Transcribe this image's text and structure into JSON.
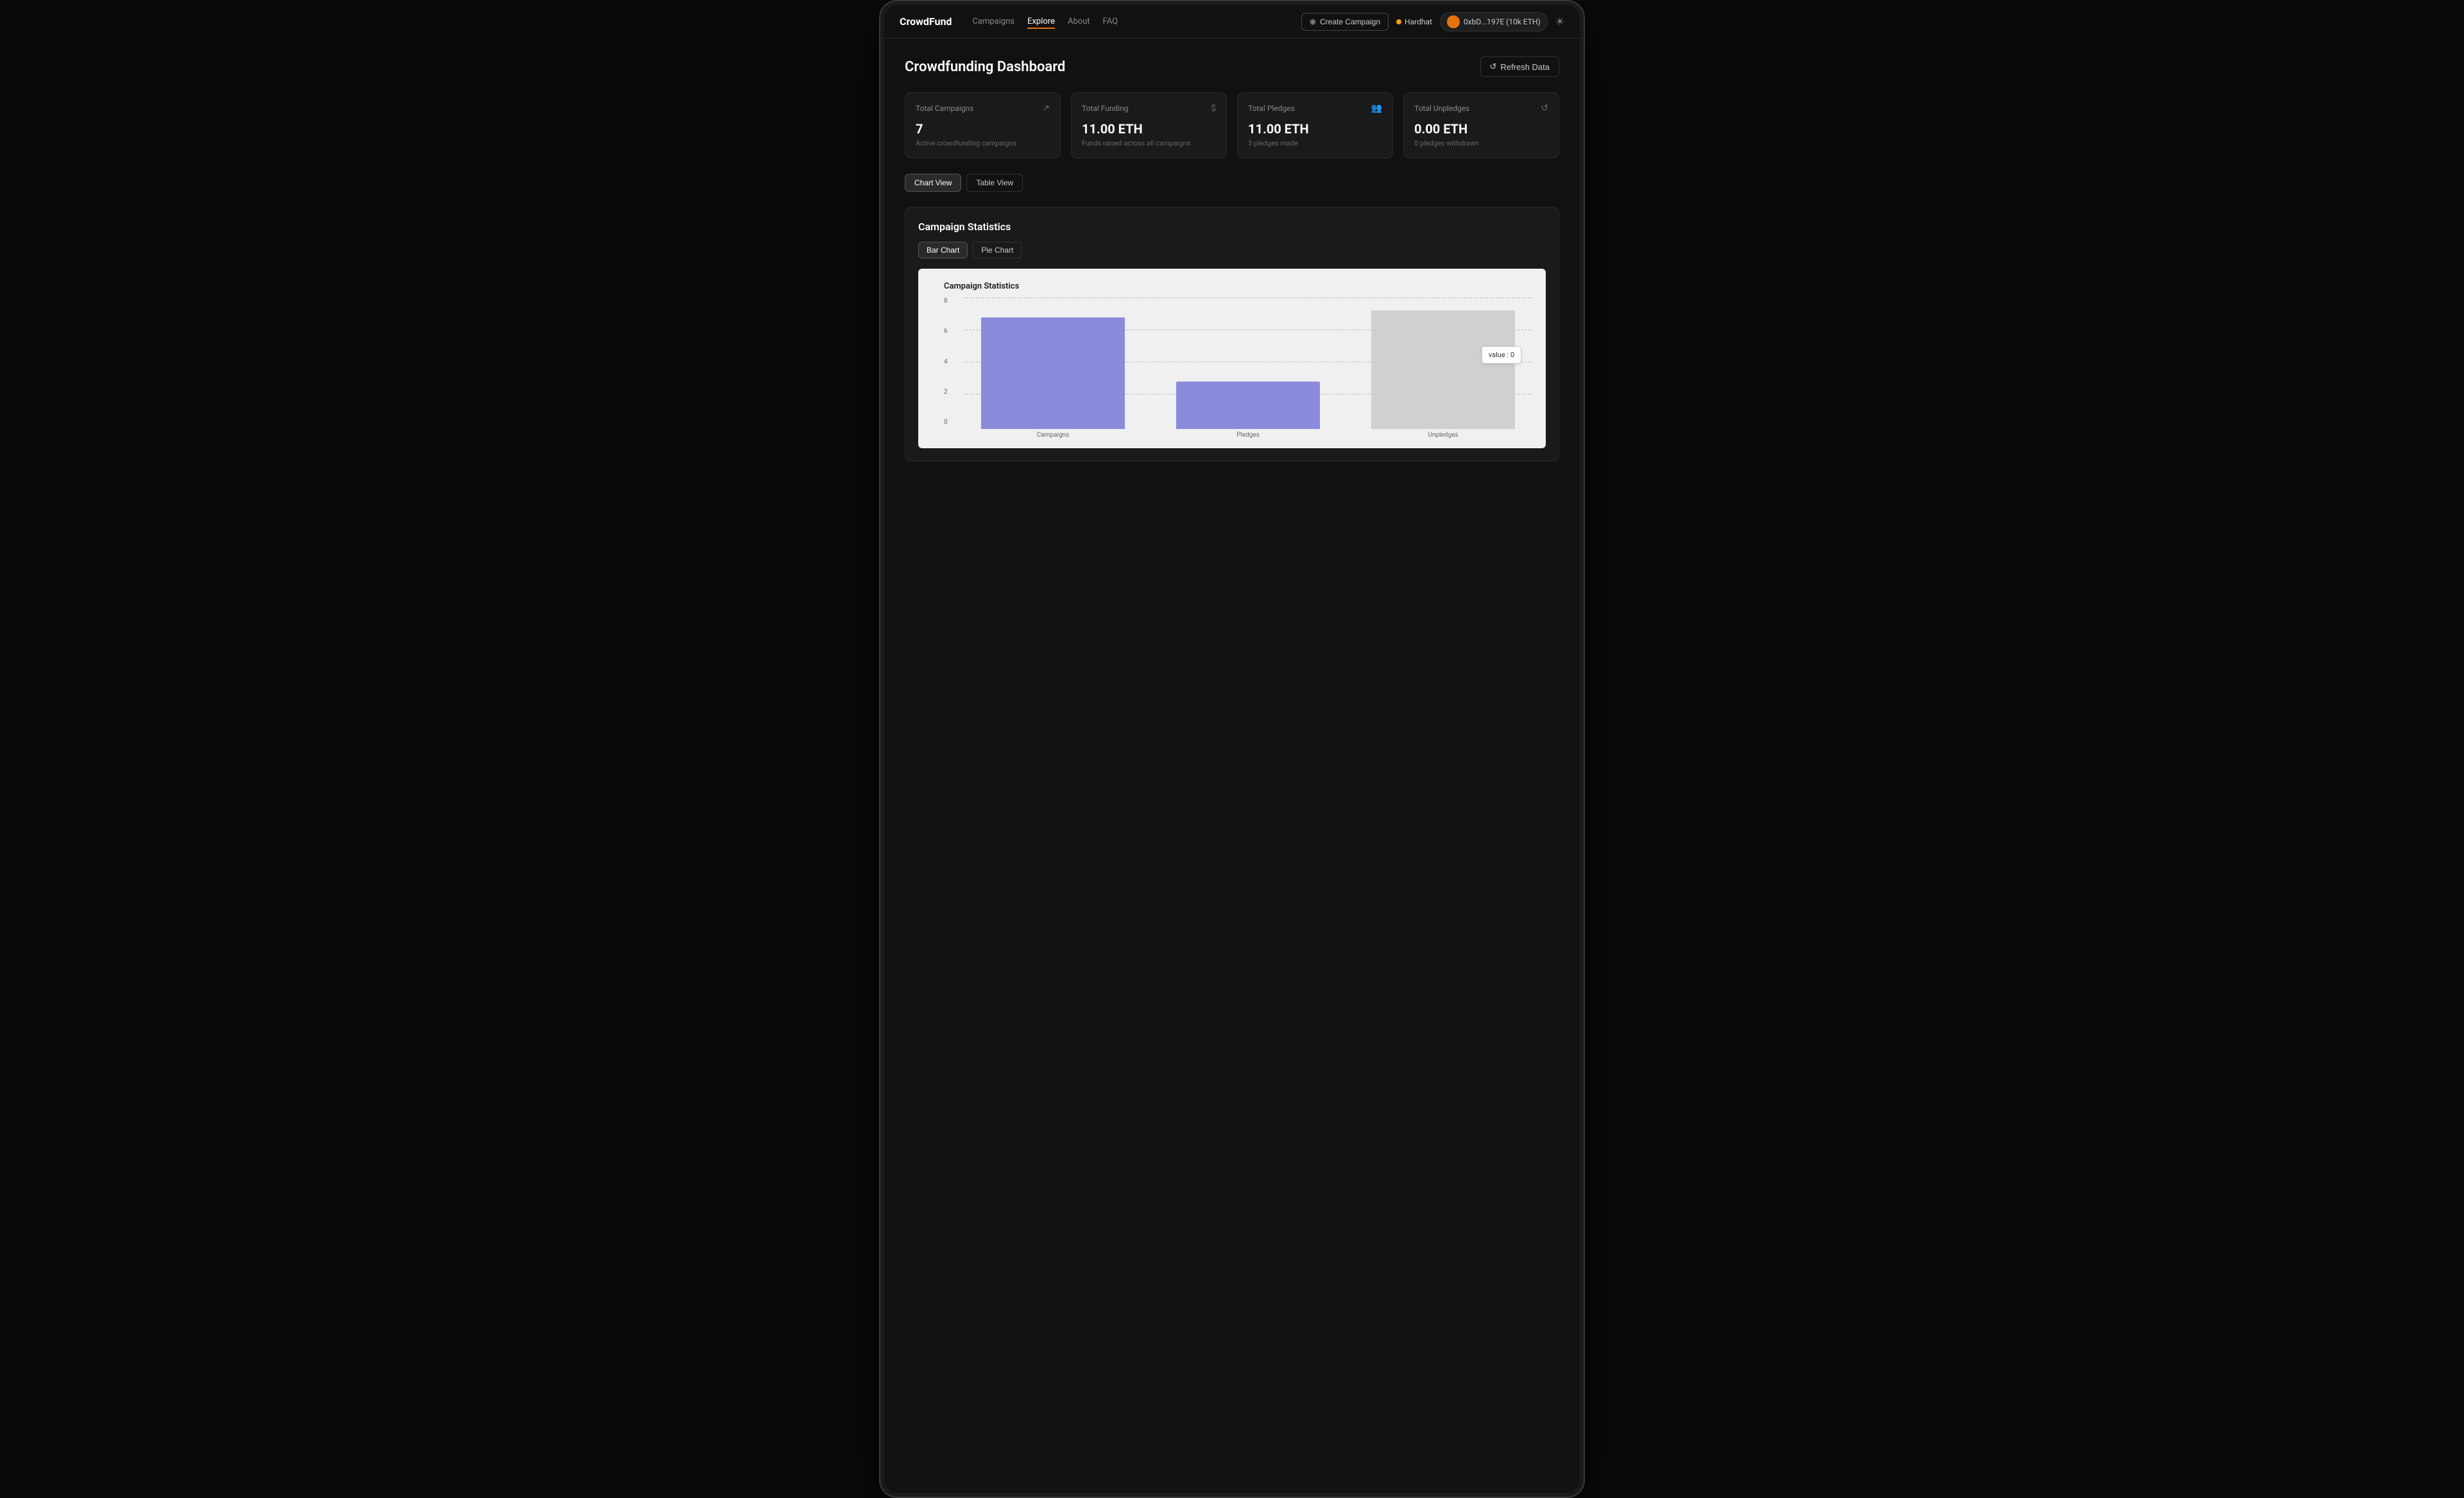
{
  "app": {
    "logo": "CrowdFund",
    "nav_links": [
      {
        "label": "Campaigns",
        "active": false
      },
      {
        "label": "Explore",
        "active": true
      },
      {
        "label": "About",
        "active": false
      },
      {
        "label": "FAQ",
        "active": false
      }
    ],
    "create_campaign_label": "Create Campaign",
    "network_label": "Hardhat",
    "wallet_address": "0xbD...197E (10k ETH)",
    "theme_icon": "☀"
  },
  "dashboard": {
    "title": "Crowdfunding Dashboard",
    "refresh_label": "Refresh Data",
    "stats": [
      {
        "label": "Total Campaigns",
        "icon": "↗",
        "value": "7",
        "sub": "Active crowdfunding campaigns"
      },
      {
        "label": "Total Funding",
        "icon": "$",
        "value": "11.00 ETH",
        "sub": "Funds raised across all campaigns"
      },
      {
        "label": "Total Pledges",
        "icon": "👥",
        "value": "11.00 ETH",
        "sub": "3 pledges made"
      },
      {
        "label": "Total Unpledges",
        "icon": "↺",
        "value": "0.00 ETH",
        "sub": "0 pledges withdrawn"
      }
    ],
    "view_buttons": [
      {
        "label": "Chart View",
        "active": true
      },
      {
        "label": "Table View",
        "active": false
      }
    ],
    "chart_section": {
      "title": "Campaign Statistics",
      "chart_types": [
        {
          "label": "Bar Chart",
          "active": true
        },
        {
          "label": "Pie Chart",
          "active": false
        }
      ],
      "chart_title": "Campaign Statistics",
      "y_axis_labels": [
        "8",
        "6",
        "4",
        "2",
        "0"
      ],
      "bars": [
        {
          "label": "Campaigns",
          "value": 7,
          "height_pct": 87,
          "color": "#8b8bdb"
        },
        {
          "label": "Pledges",
          "value": 3,
          "height_pct": 37,
          "color": "#9090cc"
        },
        {
          "label": "Unpledges",
          "value": 0,
          "height_pct": 0,
          "color": "#d0d0d0"
        }
      ],
      "tooltip": "value : 0"
    }
  }
}
